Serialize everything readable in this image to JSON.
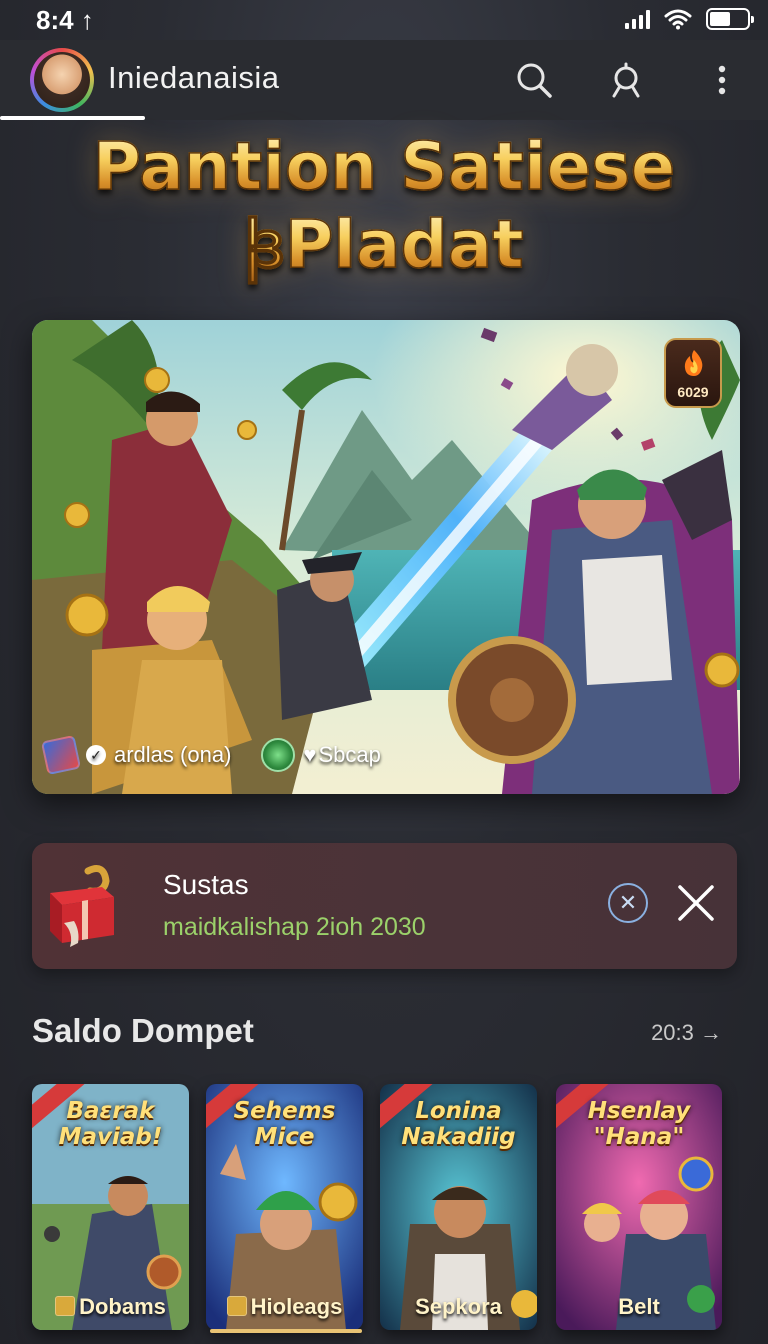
{
  "status_bar": {
    "time": "8:4 ↑"
  },
  "header": {
    "title": "Iniedanaisia"
  },
  "hero": {
    "line1": "Pantion Satiese",
    "line2": "ꟓPladat"
  },
  "banner": {
    "badge_number": "6029",
    "footer_left": "ardlas (ona)",
    "footer_right": "Sbcap"
  },
  "notice": {
    "title": "Sustas",
    "subtitle": "maidkalishap 2ioh 2030"
  },
  "section": {
    "title": "Saldo Dompet",
    "more": "20:3 →"
  },
  "games": [
    {
      "title": "Baɛrak Maviab!",
      "label": "Dobams"
    },
    {
      "title": "Sehems Mice",
      "label": "Hioleags"
    },
    {
      "title": "Lonina Nakadiig",
      "label": "Sepkora"
    },
    {
      "title": "Hsenlay \"Hana\"",
      "label": "Belt"
    }
  ],
  "colors": {
    "background": "#2a2c33",
    "header": "#2a2c31",
    "accent_gold": "#f7cf5e",
    "notice_bg": "#4a3338",
    "notice_subtitle": "#9bd16a"
  },
  "icons": [
    "search-icon",
    "profile-search-icon",
    "more-vertical-icon",
    "wifi-icon",
    "battery-icon",
    "info-circle-icon",
    "close-icon",
    "gift-icon",
    "flame-icon"
  ]
}
